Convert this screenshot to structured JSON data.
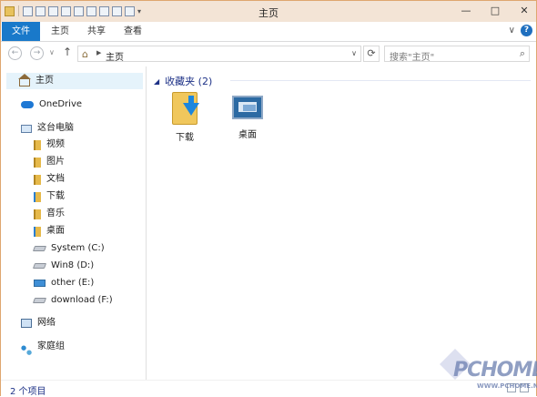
{
  "window": {
    "title": "主页"
  },
  "titlebar": {
    "min": "—",
    "max": "□",
    "close": "✕"
  },
  "ribbon": {
    "tabs": {
      "file": "文件",
      "home": "主页",
      "share": "共享",
      "view": "查看"
    },
    "help": "?",
    "collapse": "∨"
  },
  "nav": {
    "back": "←",
    "forward": "→",
    "up": "↑",
    "recent": "∨",
    "address": "主页",
    "refresh": "⟳"
  },
  "search": {
    "placeholder": "搜索\"主页\""
  },
  "sidebar": {
    "items": [
      {
        "label": "主页",
        "icon": "home-icon"
      },
      {
        "label": "OneDrive",
        "icon": "onedrive-icon"
      },
      {
        "label": "这台电脑",
        "icon": "computer-icon"
      },
      {
        "label": "视频",
        "icon": "videos-folder-icon"
      },
      {
        "label": "图片",
        "icon": "pictures-folder-icon"
      },
      {
        "label": "文档",
        "icon": "documents-folder-icon"
      },
      {
        "label": "下载",
        "icon": "downloads-folder-icon"
      },
      {
        "label": "音乐",
        "icon": "music-folder-icon"
      },
      {
        "label": "桌面",
        "icon": "desktop-folder-icon"
      },
      {
        "label": "System (C:)",
        "icon": "drive-icon"
      },
      {
        "label": "Win8 (D:)",
        "icon": "drive-icon"
      },
      {
        "label": "other (E:)",
        "icon": "windows-drive-icon"
      },
      {
        "label": "download (F:)",
        "icon": "drive-icon"
      },
      {
        "label": "网络",
        "icon": "network-icon"
      },
      {
        "label": "家庭组",
        "icon": "homegroup-icon"
      }
    ]
  },
  "main": {
    "group_title": "收藏夹 (2)",
    "tiles": [
      {
        "label": "下载",
        "icon": "downloads-folder-icon"
      },
      {
        "label": "桌面",
        "icon": "desktop-icon"
      }
    ]
  },
  "status": {
    "count": "2 个项目"
  },
  "watermark": {
    "logo": "PCHOME",
    "site": "WWW.PCHOME.NET"
  },
  "colors": {
    "accent": "#1979ca",
    "titlebar": "#f3e4d6",
    "border": "#dfa66f",
    "group": "#1e3287",
    "selected": "#e5f3fb"
  }
}
